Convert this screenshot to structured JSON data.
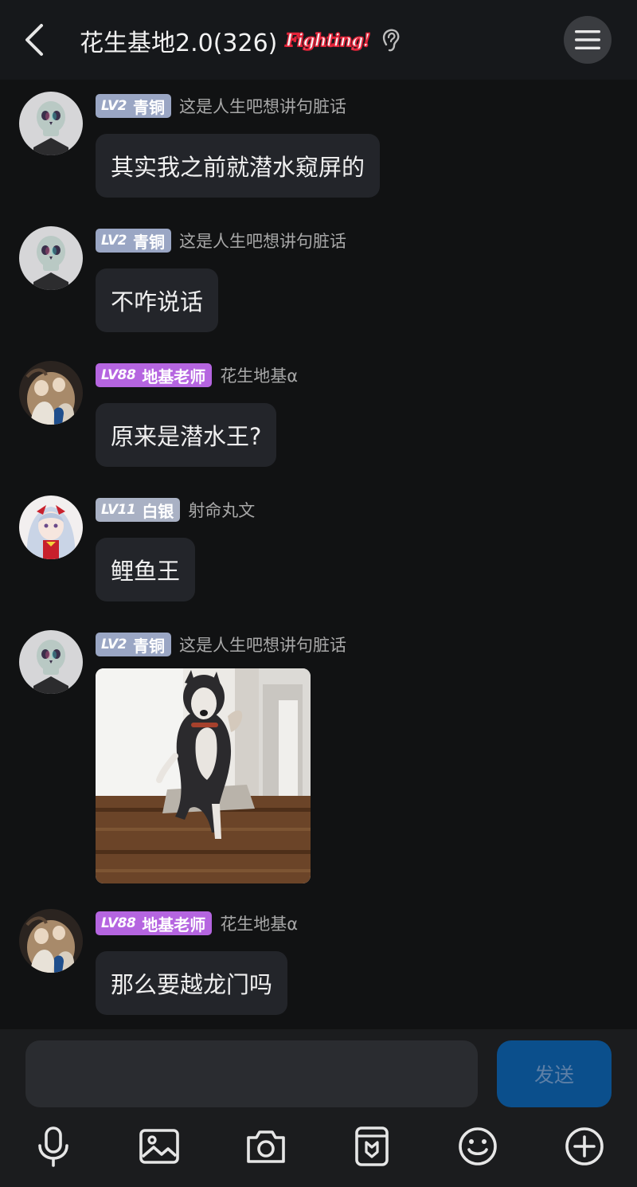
{
  "header": {
    "title": "花生基地2.0(326)",
    "decoration_text": "Fighting!"
  },
  "messages": [
    {
      "badge_level": "LV2",
      "badge_title": "青铜",
      "nickname": "这是人生吧想讲句脏话",
      "text": "其实我之前就潜水窥屏的"
    },
    {
      "badge_level": "LV2",
      "badge_title": "青铜",
      "nickname": "这是人生吧想讲句脏话",
      "text": "不咋说话"
    },
    {
      "badge_level": "LV88",
      "badge_title": "地基老师",
      "nickname": "花生地基α",
      "text": "原来是潜水王?"
    },
    {
      "badge_level": "LV11",
      "badge_title": "白银",
      "nickname": "射命丸文",
      "text": "鲤鱼王"
    },
    {
      "badge_level": "LV2",
      "badge_title": "青铜",
      "nickname": "这是人生吧想讲句脏话",
      "image": "husky-dancing-gif"
    },
    {
      "badge_level": "LV88",
      "badge_title": "地基老师",
      "nickname": "花生地基α",
      "text": "那么要越龙门吗"
    }
  ],
  "composer": {
    "input_value": "",
    "send_label": "发送"
  },
  "toolbar": {
    "icons": [
      "microphone-icon",
      "image-icon",
      "camera-icon",
      "sticker-icon",
      "emoji-icon",
      "plus-icon"
    ]
  },
  "colors": {
    "background": "#111213",
    "bubble": "#23252a",
    "badge_bronze": "#9aa6c4",
    "badge_silver": "#a9b1c4",
    "badge_master": "#b565e0",
    "send_button": "#0b4f8c"
  }
}
